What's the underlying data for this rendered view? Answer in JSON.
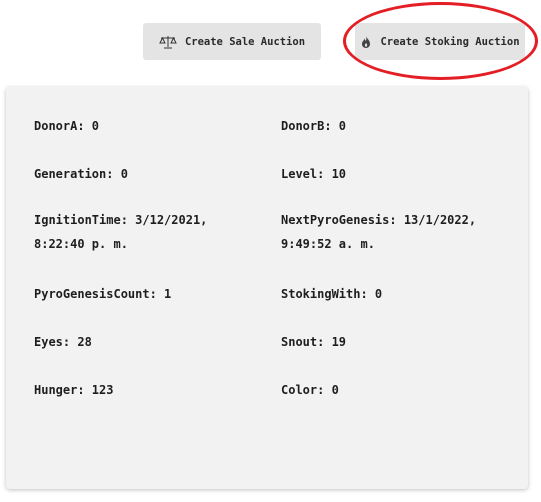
{
  "actions": {
    "sale_label": "Create Sale Auction",
    "stoking_label": "Create Stoking Auction",
    "sale_icon": "scale-icon",
    "stoking_icon": "flame-icon"
  },
  "fields": {
    "donor_a": "DonorA: 0",
    "donor_b": "DonorB: 0",
    "generation": "Generation: 0",
    "level": "Level: 10",
    "ignition_time": "IgnitionTime: 3/12/2021, 8:22:40 p. m.",
    "next_pyro_genesis": "NextPyroGenesis: 13/1/2022, 9:49:52 a. m.",
    "pyro_genesis_count": "PyroGenesisCount: 1",
    "stoking_with": "StokingWith: 0",
    "eyes": "Eyes: 28",
    "snout": "Snout: 19",
    "hunger": "Hunger: 123",
    "color": "Color: 0"
  },
  "colors": {
    "button_bg": "#e4e4e4",
    "card_bg": "#f2f2f2",
    "highlight": "#e31e24"
  }
}
